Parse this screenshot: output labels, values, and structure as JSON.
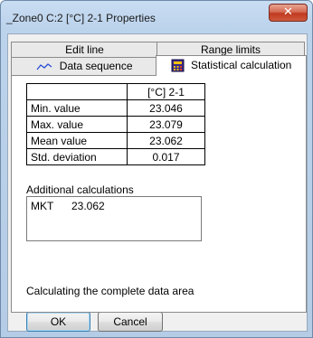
{
  "window": {
    "title": "_Zone0 C:2 [°C] 2-1 Properties",
    "close_glyph": "✕"
  },
  "tabs": {
    "row_back": [
      {
        "label": "Edit line"
      },
      {
        "label": "Range limits"
      }
    ],
    "row_front": [
      {
        "label": "Data sequence",
        "icon": "line-chart-icon"
      },
      {
        "label": "Statistical calculation",
        "icon": "calculator-icon",
        "selected": true
      }
    ]
  },
  "stats": {
    "column_header": "[°C] 2-1",
    "rows": [
      {
        "label": "Min. value",
        "value": "23.046"
      },
      {
        "label": "Max. value",
        "value": "23.079"
      },
      {
        "label": "Mean value",
        "value": "23.062"
      },
      {
        "label": "Std. deviation",
        "value": "0.017"
      }
    ]
  },
  "additional": {
    "label": "Additional calculations",
    "items": [
      {
        "name": "MKT",
        "value": "23.062"
      }
    ]
  },
  "status": "Calculating the complete data area",
  "buttons": {
    "ok": "OK",
    "cancel": "Cancel"
  },
  "colors": {
    "title_bar": "#c9ddf2",
    "close_button": "#c0391f",
    "dialog_bg": "#f0f0f0"
  }
}
